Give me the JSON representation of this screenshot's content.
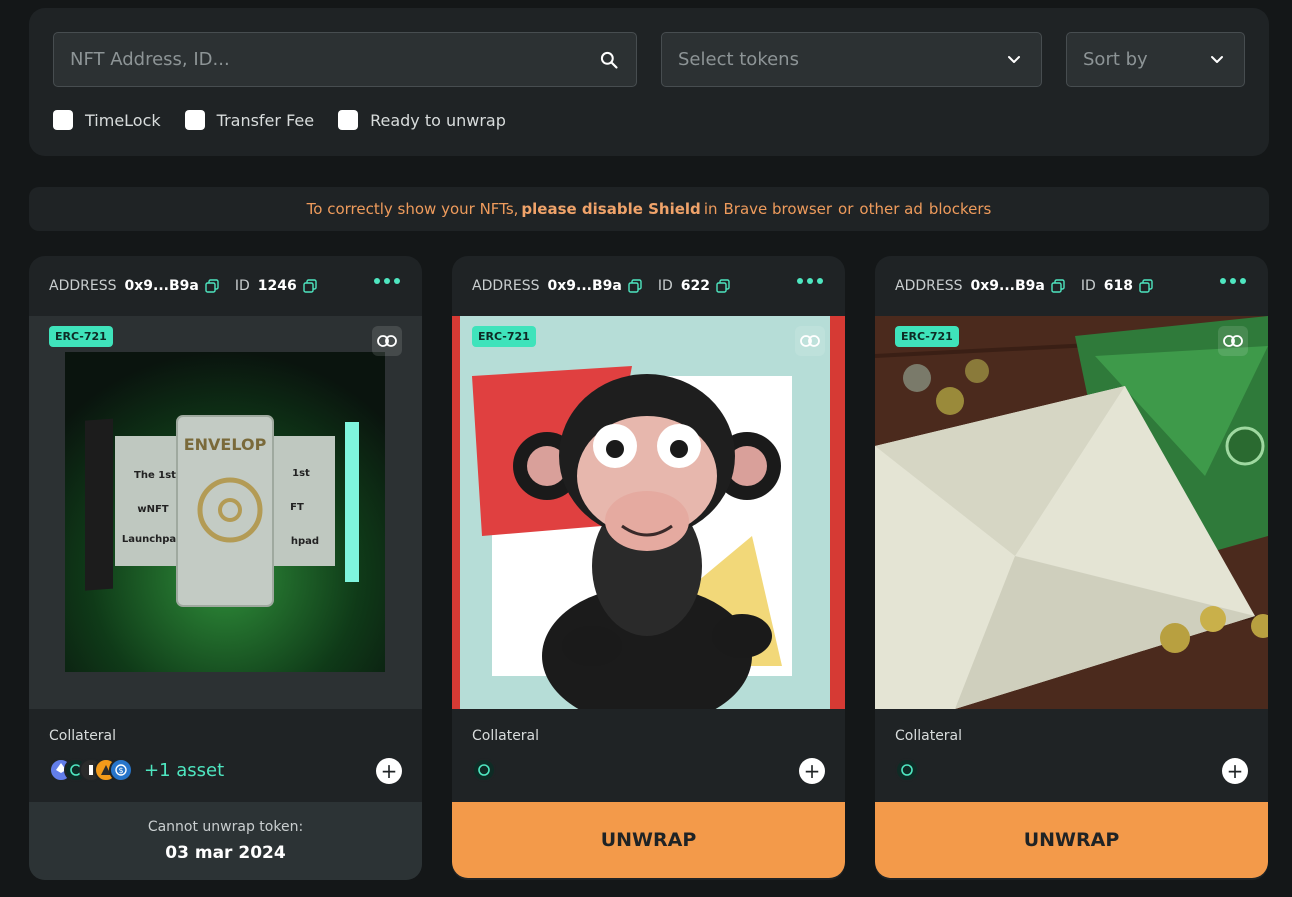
{
  "filters": {
    "search_placeholder": "NFT Address, ID...",
    "select_tokens_placeholder": "Select tokens",
    "sort_by_placeholder": "Sort by",
    "checkboxes": [
      {
        "label": "TimeLock",
        "checked": false
      },
      {
        "label": "Transfer Fee",
        "checked": false
      },
      {
        "label": "Ready to unwrap",
        "checked": false
      }
    ]
  },
  "banner": {
    "part1": "To correctly show your NFTs,",
    "bold": "please disable Shield",
    "part2": "in",
    "part3": "Brave browser",
    "part4": "or",
    "part5": "other ad",
    "part6": "blockers"
  },
  "cards": [
    {
      "address_label": "ADDRESS",
      "address": "0x9...B9a",
      "id_label": "ID",
      "id": "1246",
      "standard": "ERC-721",
      "collateral_label": "Collateral",
      "extra_assets": "+1 asset",
      "footer_type": "disabled",
      "footer_text": "Cannot unwrap token:",
      "footer_date": "03 mar 2024",
      "image_text": [
        "ENVELOP",
        "The 1st",
        "wNFT",
        "Launchpa",
        "1st",
        "FT",
        "hpad"
      ]
    },
    {
      "address_label": "ADDRESS",
      "address": "0x9...B9a",
      "id_label": "ID",
      "id": "622",
      "standard": "ERC-721",
      "collateral_label": "Collateral",
      "footer_type": "unwrap",
      "footer_text": "UNWRAP"
    },
    {
      "address_label": "ADDRESS",
      "address": "0x9...B9a",
      "id_label": "ID",
      "id": "618",
      "standard": "ERC-721",
      "collateral_label": "Collateral",
      "footer_type": "unwrap",
      "footer_text": "UNWRAP"
    }
  ],
  "colors": {
    "accent": "#4ee6c0",
    "unwrap": "#f39a4a",
    "warning_text": "#ee9b5c"
  }
}
